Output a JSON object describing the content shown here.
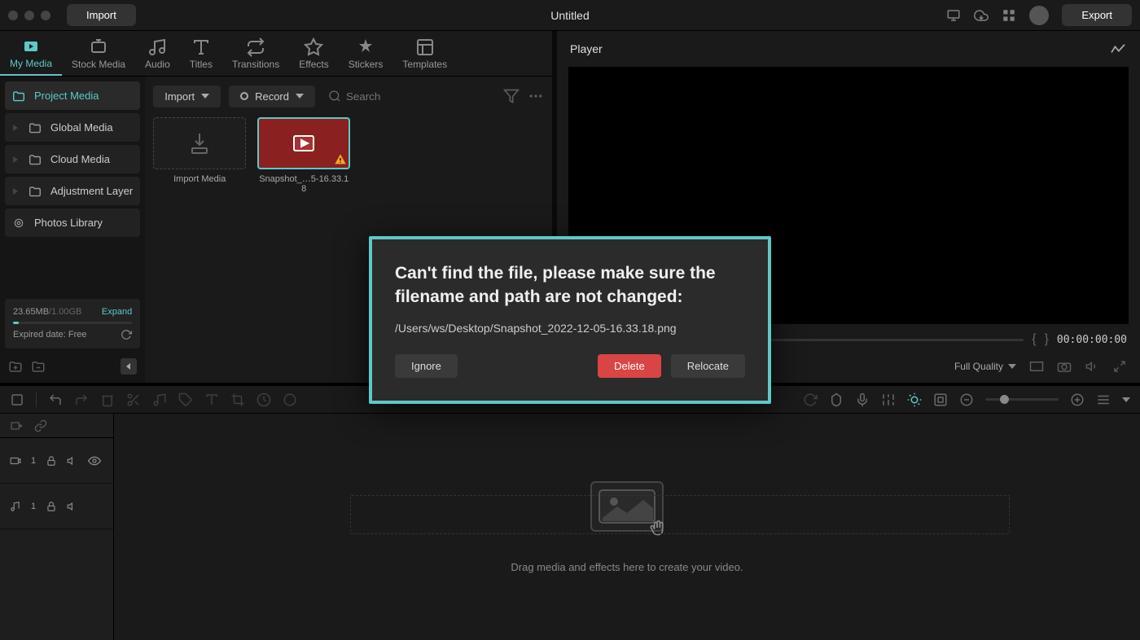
{
  "titlebar": {
    "import": "Import",
    "title": "Untitled",
    "export": "Export"
  },
  "tabs": [
    {
      "label": "My Media",
      "active": true
    },
    {
      "label": "Stock Media"
    },
    {
      "label": "Audio"
    },
    {
      "label": "Titles"
    },
    {
      "label": "Transitions"
    },
    {
      "label": "Effects"
    },
    {
      "label": "Stickers"
    },
    {
      "label": "Templates"
    }
  ],
  "sidebar": {
    "items": [
      {
        "label": "Project Media",
        "active": true
      },
      {
        "label": "Global Media"
      },
      {
        "label": "Cloud Media"
      },
      {
        "label": "Adjustment Layer"
      },
      {
        "label": "Photos Library"
      }
    ],
    "storage": {
      "used": "23.65MB",
      "total": "/1.00GB",
      "expand": "Expand",
      "expired": "Expired date: Free"
    }
  },
  "media_toolbar": {
    "import": "Import",
    "record": "Record",
    "search_placeholder": "Search"
  },
  "media": {
    "import_label": "Import Media",
    "missing_label": "Snapshot_…5-16.33.18"
  },
  "player": {
    "header": "Player",
    "time": "00:00:00:00",
    "quality": "Full Quality"
  },
  "timeline": {
    "track_video": "1",
    "track_audio": "1",
    "hint": "Drag media and effects here to create your video."
  },
  "modal": {
    "title": "Can't find the file, please make sure the filename and path are not changed:",
    "path": "/Users/ws/Desktop/Snapshot_2022-12-05-16.33.18.png",
    "ignore": "Ignore",
    "delete": "Delete",
    "relocate": "Relocate"
  }
}
